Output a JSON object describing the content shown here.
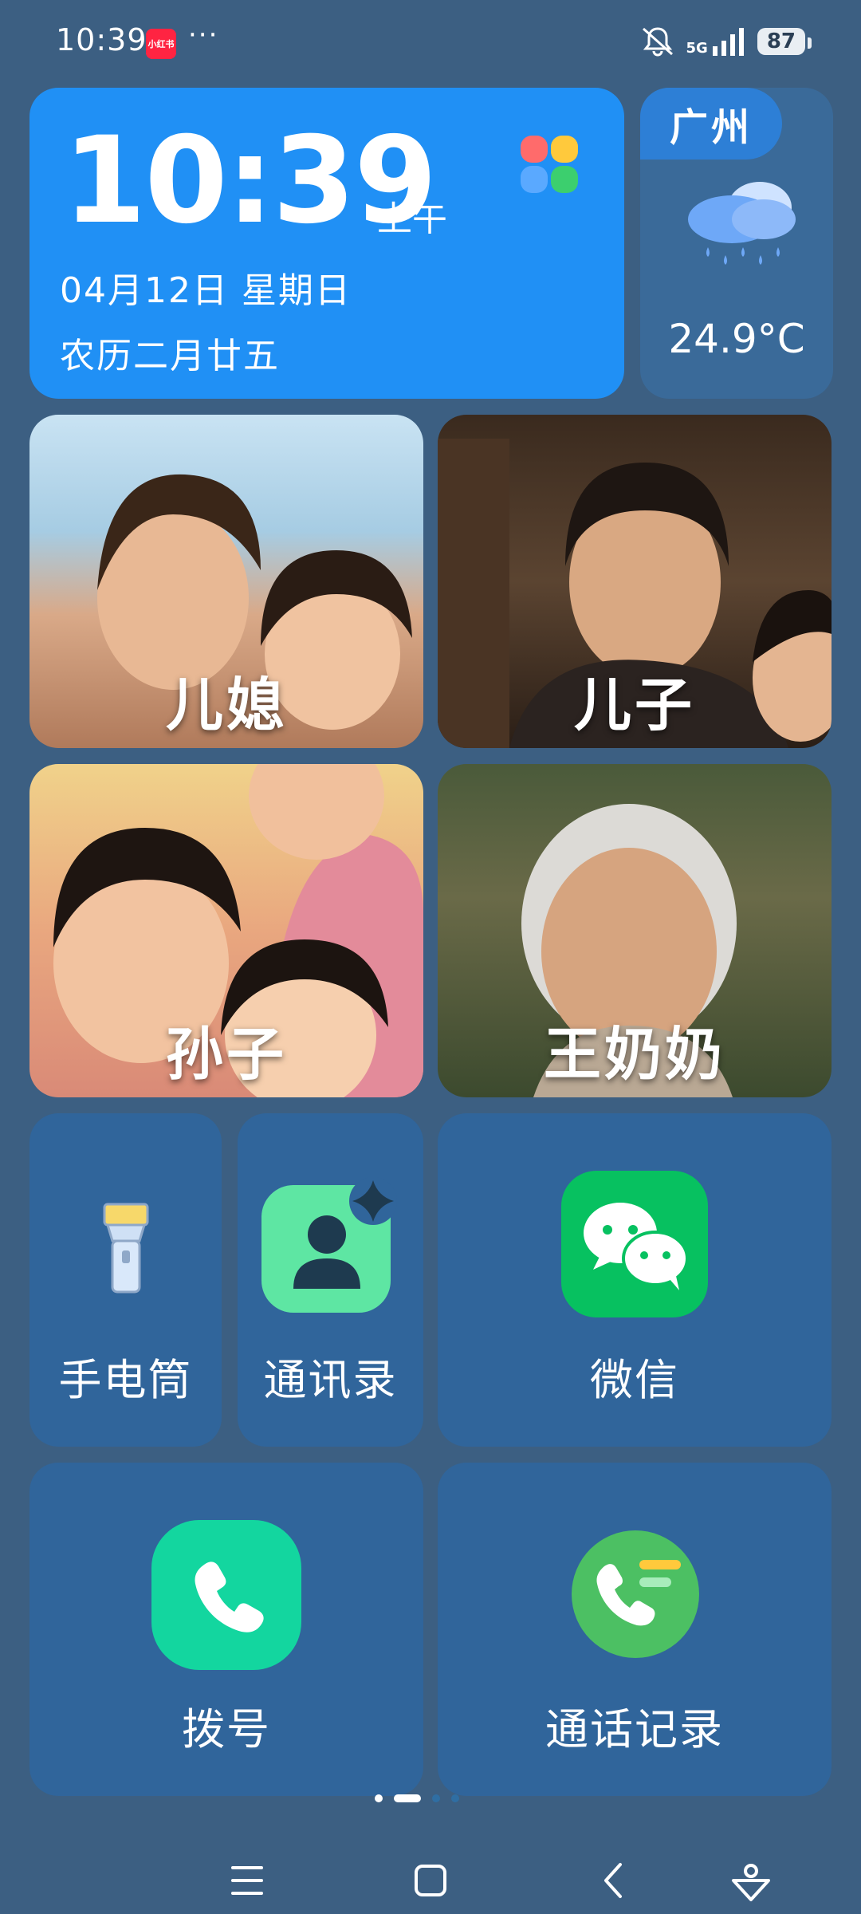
{
  "status_bar": {
    "time": "10:39",
    "app_badge": "小红书",
    "more": "···",
    "network": "5G",
    "battery": "87"
  },
  "clock": {
    "time": "10:39",
    "ampm": "上午",
    "date": "04月12日  星期日",
    "lunar": "农历二月廿五"
  },
  "weather": {
    "city": "广州",
    "temperature": "24.9°C",
    "icon": "rain-cloud-icon"
  },
  "contacts": [
    {
      "label": "儿媳"
    },
    {
      "label": "儿子"
    },
    {
      "label": "孙子"
    },
    {
      "label": "王奶奶"
    }
  ],
  "apps": {
    "flashlight": "手电筒",
    "contacts": "通讯录",
    "wechat": "微信",
    "dialer": "拨号",
    "call_log": "通话记录"
  },
  "page_indicator": {
    "pages": 4,
    "current": 2
  },
  "colors": {
    "background": "#3c5f82",
    "clock_card": "#2090f5",
    "tile": "#30659b",
    "wechat": "#07c160",
    "dialer": "#13d69f"
  }
}
